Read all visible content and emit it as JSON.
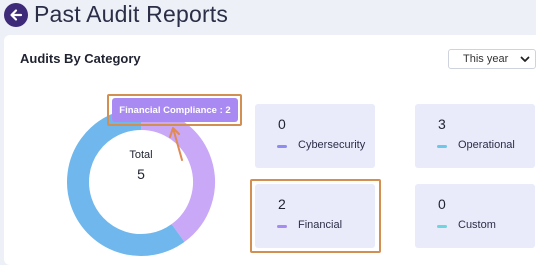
{
  "header": {
    "title": "Past Audit Reports"
  },
  "card": {
    "title": "Audits By Category",
    "period": {
      "selected": "This year"
    }
  },
  "donut": {
    "center_label": "Total",
    "center_value": "5",
    "tooltip": "Financial Compliance :  2",
    "segments": [
      {
        "name": "Financial",
        "value": 2,
        "color": "#c9a8f7"
      },
      {
        "name": "Operational",
        "value": 3,
        "color": "#6fb7ec"
      }
    ]
  },
  "categories": [
    {
      "count": "0",
      "name": "Cybersecurity",
      "color": "#8e8cf0"
    },
    {
      "count": "3",
      "name": "Operational",
      "color": "#6cc7e8"
    },
    {
      "count": "2",
      "name": "Financial",
      "color": "#a58cf0"
    },
    {
      "count": "0",
      "name": "Custom",
      "color": "#6cd6e0"
    }
  ]
}
